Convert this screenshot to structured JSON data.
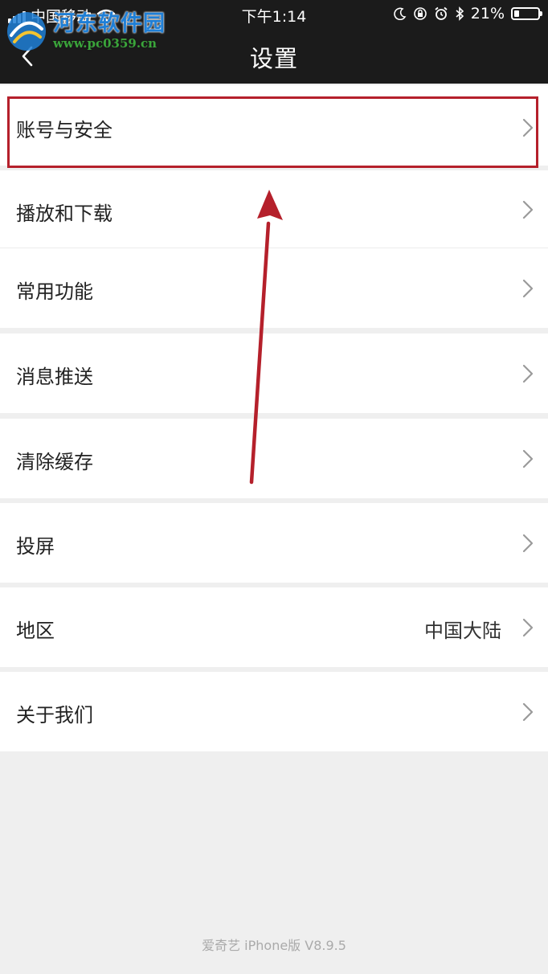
{
  "status_bar": {
    "carrier": "中国移动",
    "time": "下午1:14",
    "battery": "21%"
  },
  "nav": {
    "title": "设置"
  },
  "watermark": {
    "name": "河东软件园",
    "url": "www.pc0359.cn"
  },
  "menu": {
    "items": [
      {
        "label": "账号与安全",
        "value": ""
      },
      {
        "label": "播放和下载",
        "value": ""
      },
      {
        "label": "常用功能",
        "value": ""
      },
      {
        "label": "消息推送",
        "value": ""
      },
      {
        "label": "清除缓存",
        "value": ""
      },
      {
        "label": "投屏",
        "value": ""
      },
      {
        "label": "地区",
        "value": "中国大陆"
      },
      {
        "label": "关于我们",
        "value": ""
      }
    ]
  },
  "footer": {
    "version": "爱奇艺 iPhone版 V8.9.5"
  },
  "colors": {
    "top_bar": "#1b1b1b",
    "background": "#efefef",
    "annotation_red": "#b5202b"
  },
  "icons": {
    "back": "chevron-left-icon",
    "row_arrow": "chevron-right-icon"
  }
}
